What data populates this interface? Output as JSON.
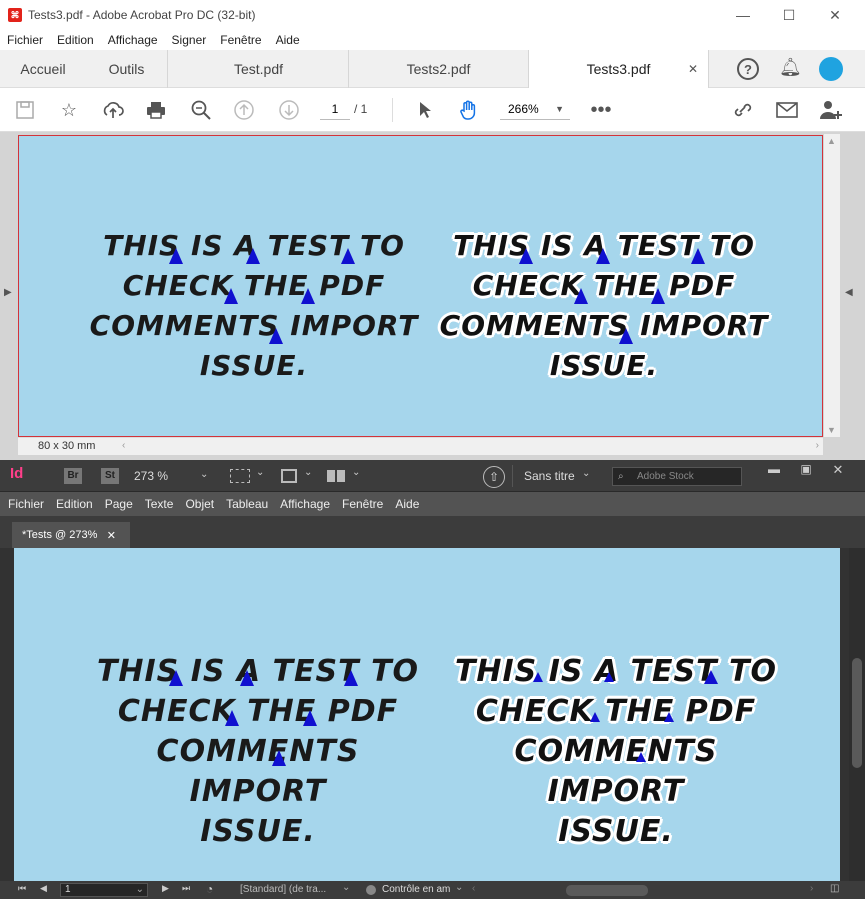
{
  "acrobat": {
    "title": "Tests3.pdf - Adobe Acrobat Pro DC (32-bit)",
    "menu": [
      "Fichier",
      "Edition",
      "Affichage",
      "Signer",
      "Fenêtre",
      "Aide"
    ],
    "home_tab": "Accueil",
    "tools_tab": "Outils",
    "doc_tabs": [
      "Test.pdf",
      "Tests2.pdf",
      "Tests3.pdf"
    ],
    "page_current": "1",
    "page_total": "/ 1",
    "zoom": "266%",
    "page_size": "80 x 30 mm",
    "text_block": "THIS IS A TEST TO\nCHECK THE PDF\nCOMMENTS IMPORT\nISSUE."
  },
  "indesign": {
    "logo": "Id",
    "br": "Br",
    "st": "St",
    "zoom": "273 %",
    "workspace": "Sans titre",
    "search_placeholder": "Adobe Stock",
    "menu": [
      "Fichier",
      "Edition",
      "Page",
      "Texte",
      "Objet",
      "Tableau",
      "Affichage",
      "Fenêtre",
      "Aide"
    ],
    "doc_tab": "*Tests @ 273%",
    "page_field": "1",
    "style_status": "[Standard] (de tra...",
    "preflight": "Contrôle en am",
    "text_block": "THIS IS A TEST TO\nCHECK THE PDF\nCOMMENTS IMPORT\nISSUE."
  }
}
